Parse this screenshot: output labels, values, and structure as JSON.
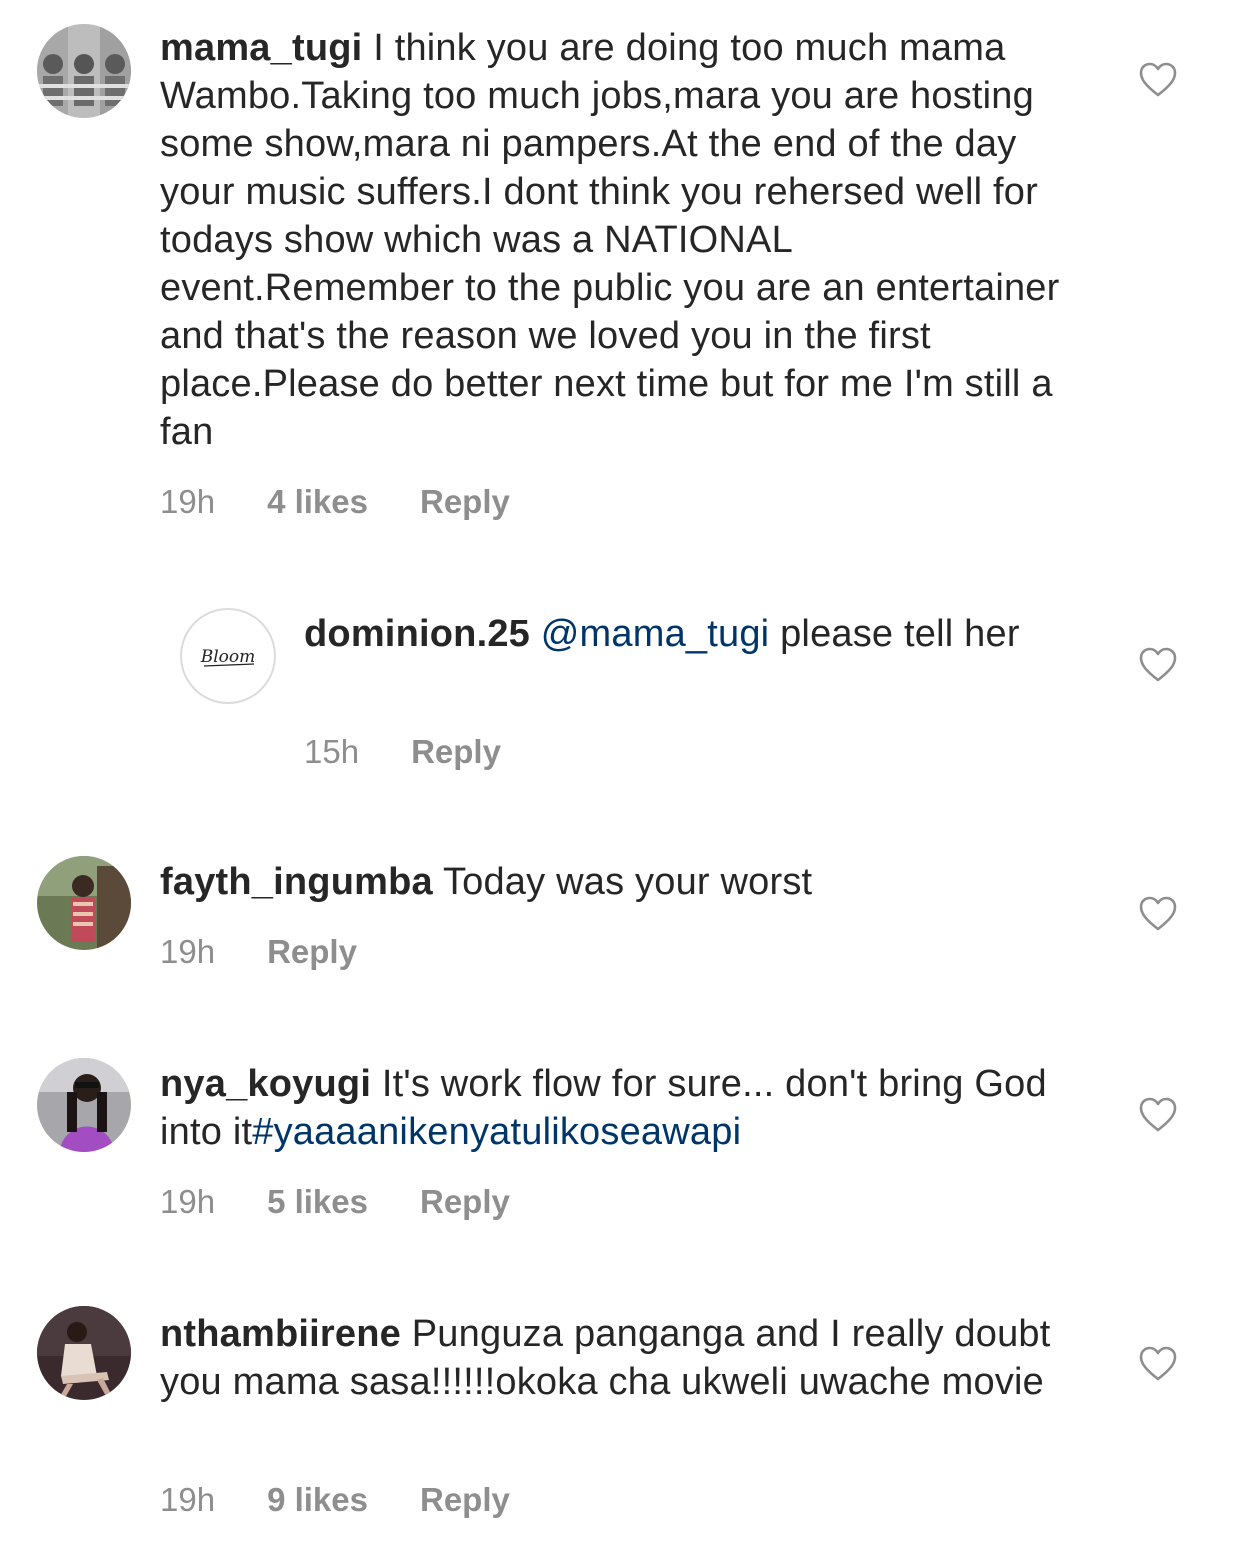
{
  "comments": [
    {
      "username": "mama_tugi",
      "text": "I think you are doing too much mama Wambo.Taking too much jobs,mara you are hosting some show,mara ni pampers.At the end of the day your music suffers.I dont think you rehersed well for todays show which was a NATIONAL event.Remember to the public you are an entertainer and that's the reason we loved you in the first place.Please do better next time but for me I'm still a fan",
      "time": "19h",
      "likes": "4 likes",
      "reply": "Reply"
    },
    {
      "username": "dominion.25",
      "mention": "@mama_tugi",
      "text": "please tell her",
      "avatar_text": "Bloom",
      "time": "15h",
      "reply": "Reply"
    },
    {
      "username": "fayth_ingumba",
      "text": "Today was your worst",
      "time": "19h",
      "reply": "Reply"
    },
    {
      "username": "nya_koyugi",
      "text": "It's work flow for sure... don't bring God into it",
      "hashtag": "#yaaaanikenyatulikoseawapi",
      "time": "19h",
      "likes": "5 likes",
      "reply": "Reply"
    },
    {
      "username": "nthambiirene",
      "text": "Punguza panganga and I really doubt you mama sasa!!!!!!okoka cha ukweli uwache movie",
      "time": "19h",
      "likes": "9 likes",
      "reply": "Reply"
    }
  ],
  "icons": {
    "like": "heart-outline-icon"
  },
  "colors": {
    "text": "#262626",
    "meta": "#8e8e8e",
    "link": "#003569"
  }
}
